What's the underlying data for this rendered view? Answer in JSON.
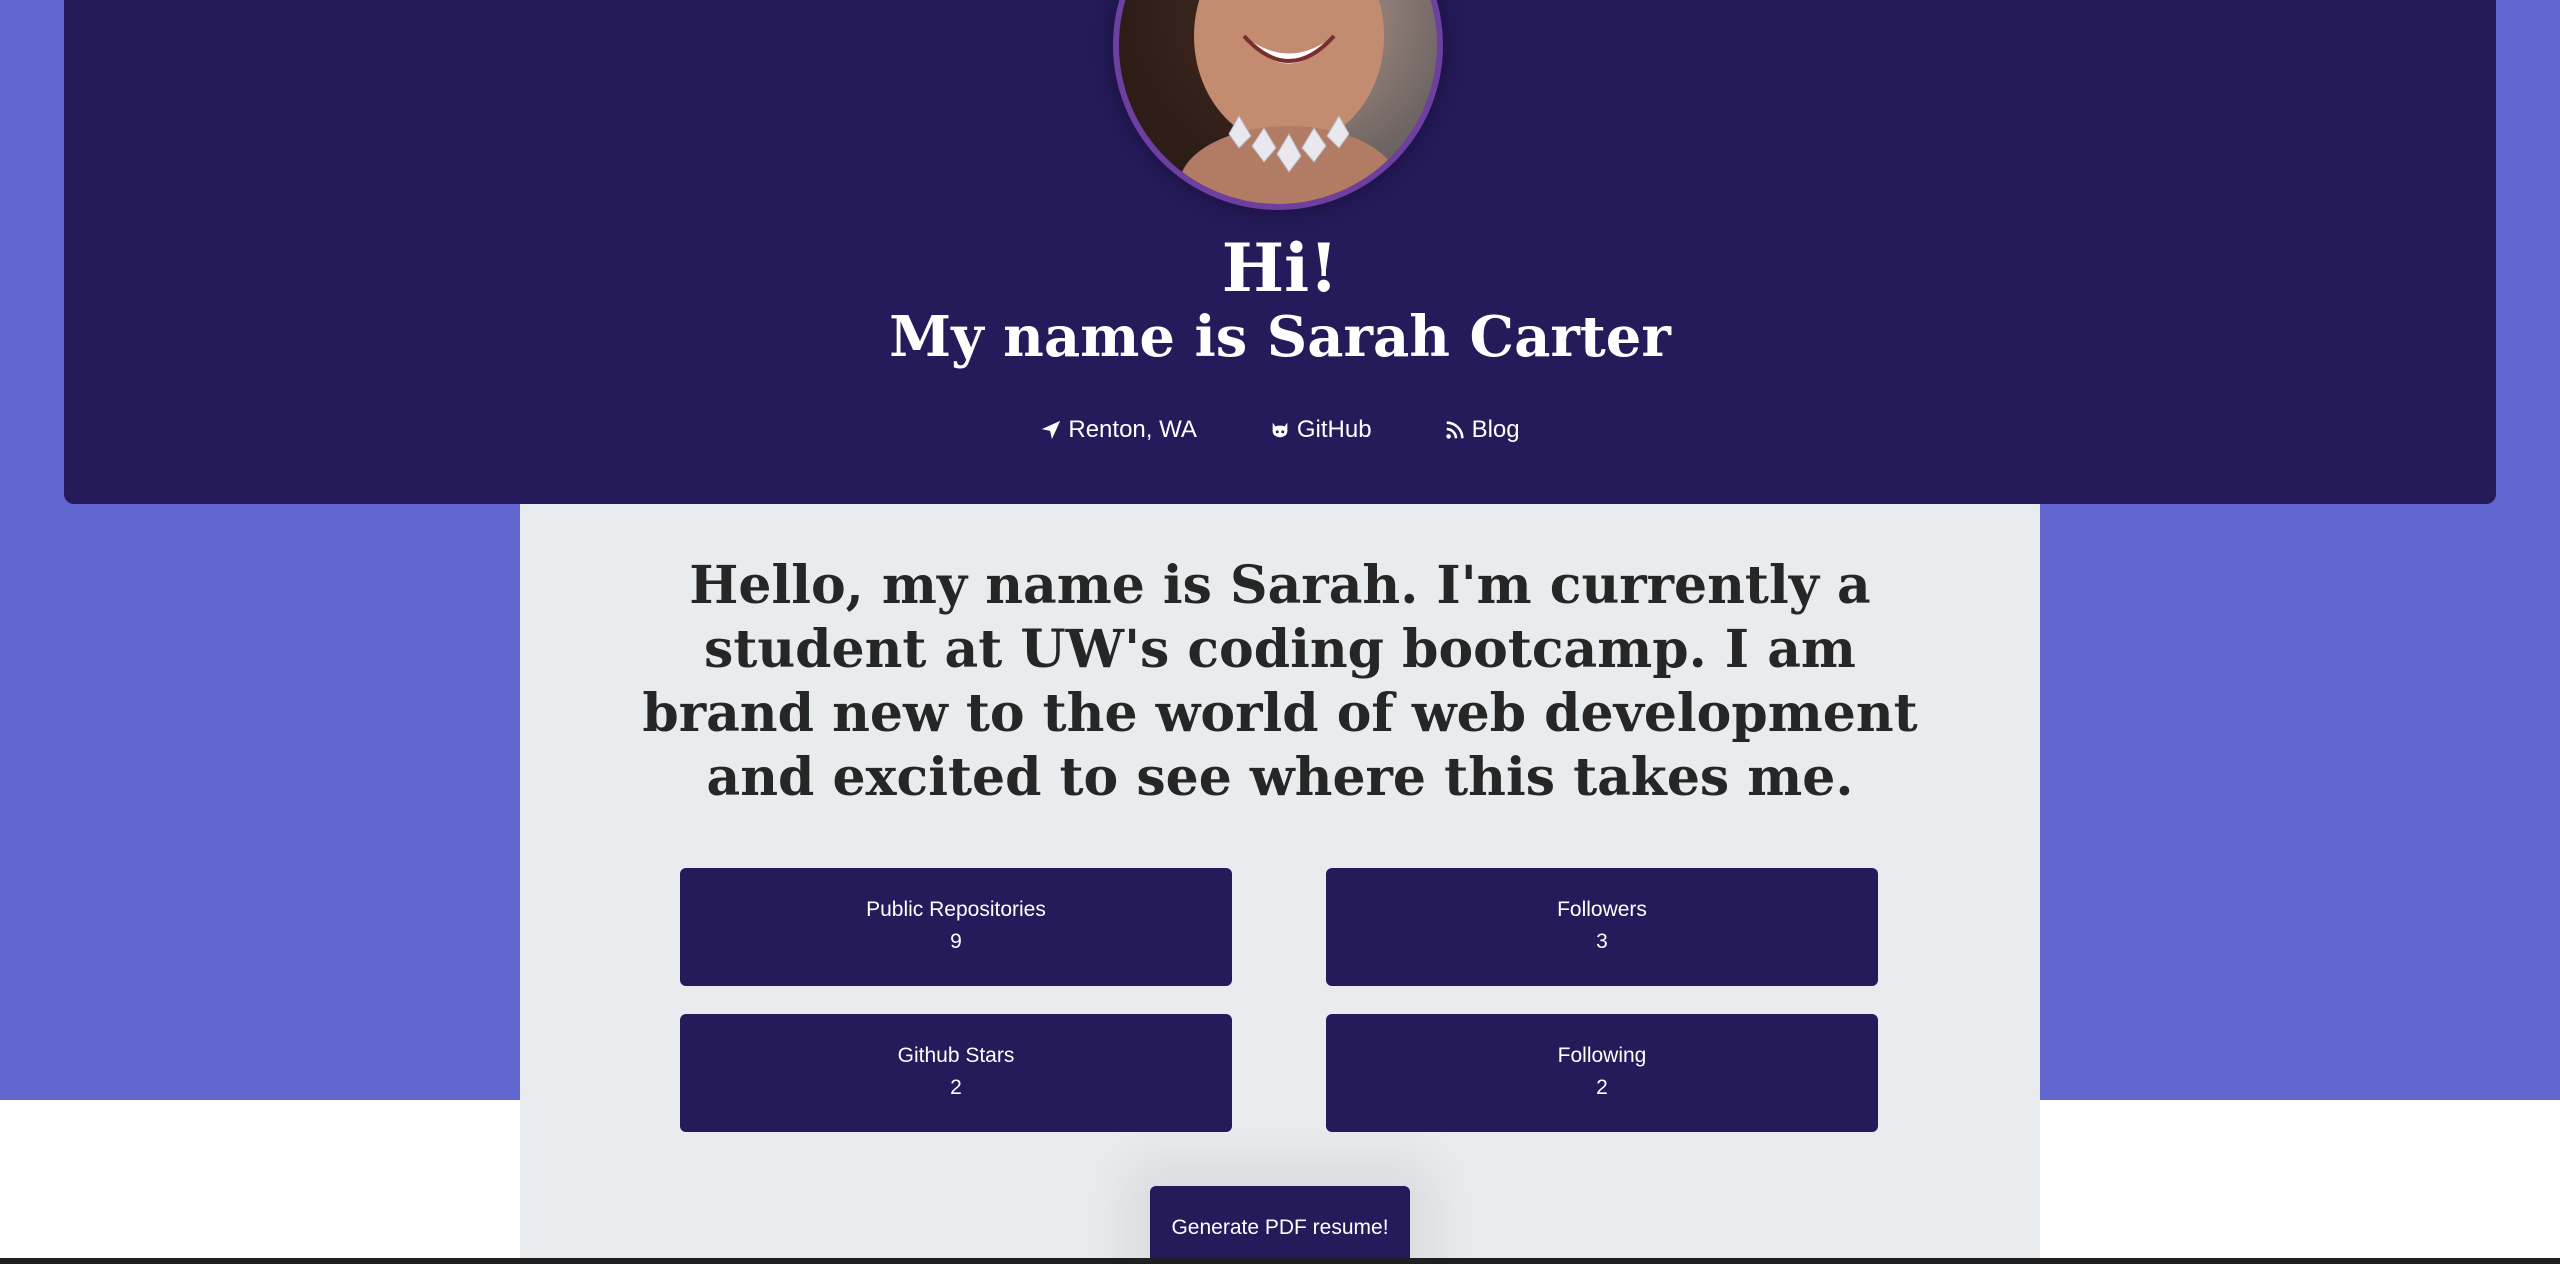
{
  "header": {
    "greeting": "Hi!",
    "name_line": "My name is Sarah Carter",
    "links": [
      {
        "label": "Renton, WA",
        "icon": "location-arrow-icon"
      },
      {
        "label": "GitHub",
        "icon": "github-icon"
      },
      {
        "label": "Blog",
        "icon": "rss-icon"
      }
    ]
  },
  "bio": "Hello, my name is Sarah. I'm currently a student at UW's coding bootcamp. I am brand new to the world of web development and excited to see where this takes me.",
  "stats": [
    {
      "label": "Public Repositories",
      "value": "9"
    },
    {
      "label": "Followers",
      "value": "3"
    },
    {
      "label": "Github Stars",
      "value": "2"
    },
    {
      "label": "Following",
      "value": "2"
    }
  ],
  "actions": {
    "generate_pdf": "Generate PDF resume!"
  },
  "colors": {
    "page_background": "#6167cf",
    "header_background": "#251a5a",
    "content_background": "#e8ecee",
    "avatar_border": "#6c3fa0"
  }
}
